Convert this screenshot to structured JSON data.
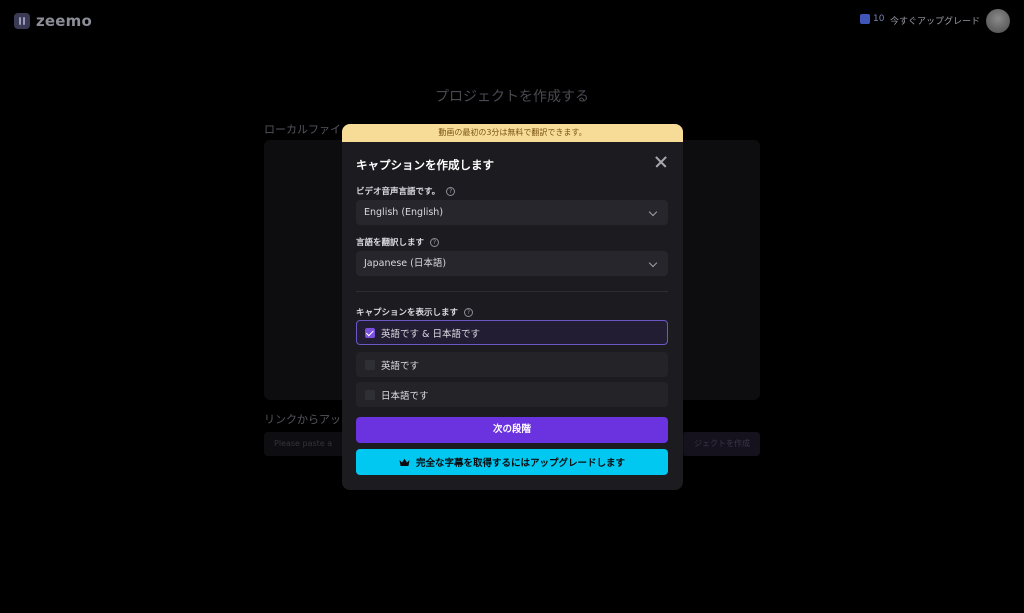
{
  "app": {
    "logo_text": "zeemo",
    "credits": "10",
    "upgrade_now": "今すぐアップグレード"
  },
  "page": {
    "title": "プロジェクトを作成する",
    "local_file_label": "ローカルファイ",
    "link_label": "リンクからアッ",
    "link_input_text": "Please paste a",
    "link_button_text": "ジェクトを作成"
  },
  "modal": {
    "banner": "動画の最初の3分は無料で翻訳できます。",
    "title": "キャプションを作成します",
    "audio_language_label": "ビデオ音声言語です。",
    "audio_language_value": "English (English)",
    "translate_label": "言語を翻訳します",
    "translate_value": "Japanese (日本語)",
    "display_label": "キャプションを表示します",
    "help_glyph": "?",
    "options": [
      {
        "label": "英語です & 日本語です",
        "checked": true
      },
      {
        "label": "英語です",
        "checked": false
      },
      {
        "label": "日本語です",
        "checked": false
      }
    ],
    "next_button": "次の段階",
    "upgrade_button": "完全な字幕を取得するにはアップグレードします"
  },
  "colors": {
    "accent_purple": "#6b32e0",
    "upgrade_cyan": "#00c8f0",
    "banner_yellow": "#f7dc97"
  }
}
